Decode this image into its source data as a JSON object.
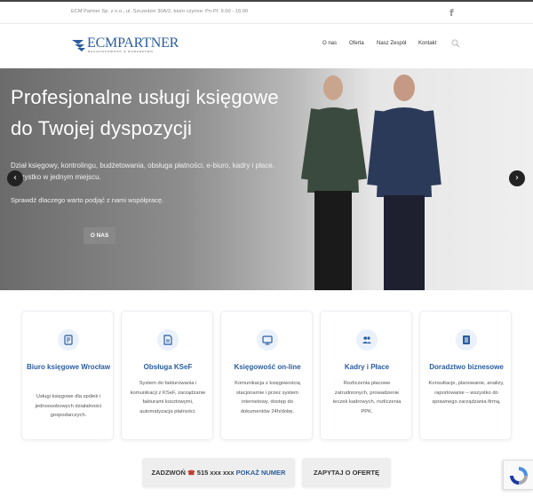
{
  "topbar": {
    "info": "ECM Partner Sp. z o.o., ul. Szczedzin 30A/2, biuro czynne: Pn-Pt: 9.00 - 16.00",
    "facebook_glyph": "f"
  },
  "logo": {
    "name": "ECMPARTNER",
    "tagline": "RACHUNKOWOŚĆ & DORADZTWO"
  },
  "nav": [
    {
      "label": "O nas"
    },
    {
      "label": "Oferta"
    },
    {
      "label": "Nasz Zespół"
    },
    {
      "label": "Kontakt"
    }
  ],
  "hero": {
    "title_line1": "Profesjonalne usługi księgowe",
    "title_line2": "do Twojej dyspozycji",
    "desc": "Dział księgowy, kontrolingu, budżetowania, obsługa płatności, e-biuro, kadry i płace. Wszystko w jednym miejscu.",
    "cta_text": "Sprawdź dlaczego warto podjąć z nami współpracę.",
    "button": "O NAS"
  },
  "cards": [
    {
      "icon": "receipt-icon",
      "title": "Biuro księgowe Wrocław",
      "desc": "Usługi księgowe dla spółek i jednoosobowych działalności gospodarczych."
    },
    {
      "icon": "invoice-icon",
      "title": "Obsługa KSeF",
      "desc": "System do fakturowania i komunikacji z KSeF, zarządzanie fakturami kosztowymi, automatyzacja płatności."
    },
    {
      "icon": "monitor-icon",
      "title": "Księgowość on-line",
      "desc": "Komunikacja z księgowością stacjonarnie i przez system internetowy, dostęp do dokumentów 24h/dobę."
    },
    {
      "icon": "users-icon",
      "title": "Kadry i Płace",
      "desc": "Rozliczenia płacowe zatrudnionych, prowadzenie teczek kadrowych, rozliczenia PPK."
    },
    {
      "icon": "list-icon",
      "title": "Doradztwo biznesowe",
      "desc": "Konsultacje, planowanie, analizy, raportowanie – wszystko do sprawnego zarządzania firmą."
    }
  ],
  "bottom": {
    "call_label": "ZADZWOŃ",
    "phone_glyph": "☎",
    "number": "515 xxx xxx",
    "show_label": "POKAŻ NUMER",
    "quote_label": "ZAPYTAJ O OFERTĘ"
  },
  "colors": {
    "brand": "#2a5d9f",
    "phone": "#c0392b"
  }
}
